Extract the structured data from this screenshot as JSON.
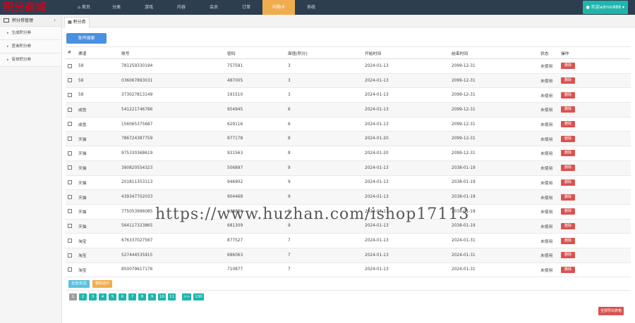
{
  "logo": "积分商城",
  "nav": [
    {
      "label": "首页",
      "active": false,
      "icon": "home-icon"
    },
    {
      "label": "分类",
      "active": false
    },
    {
      "label": "游戏",
      "active": false
    },
    {
      "label": "内容",
      "active": false
    },
    {
      "label": "会员",
      "active": false
    },
    {
      "label": "订单",
      "active": false
    },
    {
      "label": "内购卡",
      "active": true
    },
    {
      "label": "系统",
      "active": false
    }
  ],
  "user": {
    "label": "欢迎admin888",
    "icon": "user-icon"
  },
  "sidebar": {
    "title": "积分券管理",
    "items": [
      {
        "label": "生成积分券"
      },
      {
        "label": "查询积分券"
      },
      {
        "label": "有效积分券"
      }
    ]
  },
  "tab": {
    "label": "积分券"
  },
  "search_button": "条件搜索",
  "table": {
    "headers": [
      "#",
      "渠道",
      "账号",
      "密码",
      "面值(积分)",
      "开始时间",
      "结束时间",
      "状态",
      "操作"
    ],
    "delete_label": "删除",
    "rows": [
      {
        "channel": "58",
        "account": "781259330194",
        "password": "757591",
        "value": "3",
        "start": "2024-01-13",
        "end": "2099-12-31",
        "status": "未使用"
      },
      {
        "channel": "58",
        "account": "036067893031",
        "password": "487005",
        "value": "3",
        "start": "2024-01-13",
        "end": "2099-12-31",
        "status": "未使用"
      },
      {
        "channel": "58",
        "account": "373027813149",
        "password": "191510",
        "value": "3",
        "start": "2024-01-13",
        "end": "2099-12-31",
        "status": "未使用"
      },
      {
        "channel": "咸鱼",
        "account": "541221746786",
        "password": "954945",
        "value": "6",
        "start": "2024-01-13",
        "end": "2099-12-31",
        "status": "未使用"
      },
      {
        "channel": "咸鱼",
        "account": "156065375687",
        "password": "629116",
        "value": "6",
        "start": "2024-01-13",
        "end": "2099-12-31",
        "status": "未使用"
      },
      {
        "channel": "天猫",
        "account": "786724387759",
        "password": "977178",
        "value": "8",
        "start": "2024-01-20",
        "end": "2099-12-31",
        "status": "未使用"
      },
      {
        "channel": "天猫",
        "account": "975330368619",
        "password": "931563",
        "value": "8",
        "start": "2024-01-20",
        "end": "2099-12-31",
        "status": "未使用"
      },
      {
        "channel": "天猫",
        "account": "390820554323",
        "password": "506897",
        "value": "9",
        "start": "2024-01-13",
        "end": "2038-01-19",
        "status": "未使用"
      },
      {
        "channel": "天猫",
        "account": "201811353113",
        "password": "946902",
        "value": "9",
        "start": "2024-01-13",
        "end": "2038-01-19",
        "status": "未使用"
      },
      {
        "channel": "天猫",
        "account": "439347702033",
        "password": "904468",
        "value": "9",
        "start": "2024-01-13",
        "end": "2038-01-19",
        "status": "未使用"
      },
      {
        "channel": "天猫",
        "account": "775053996085",
        "password": "938886",
        "value": "9",
        "start": "2024-01-13",
        "end": "2038-01-19",
        "status": "未使用"
      },
      {
        "channel": "天猫",
        "account": "564117323865",
        "password": "681309",
        "value": "9",
        "start": "2024-01-13",
        "end": "2038-01-19",
        "status": "未使用"
      },
      {
        "channel": "淘宝",
        "account": "676337027567",
        "password": "877527",
        "value": "7",
        "start": "2024-01-13",
        "end": "2024-01-31",
        "status": "未使用"
      },
      {
        "channel": "淘宝",
        "account": "527444535915",
        "password": "686063",
        "value": "7",
        "start": "2024-01-13",
        "end": "2024-01-31",
        "status": "未使用"
      },
      {
        "channel": "淘宝",
        "account": "850079617176",
        "password": "710877",
        "value": "7",
        "start": "2024-01-13",
        "end": "2024-01-31",
        "status": "未使用"
      }
    ]
  },
  "footer": {
    "select_all": "全选/反选",
    "delete_selected": "删除选中"
  },
  "pagination": [
    "1",
    "2",
    "3",
    "4",
    "5",
    "6",
    "7",
    "8",
    "9",
    "10",
    "11",
    ">>",
    "130"
  ],
  "pagination_current": "1",
  "export_button": "全部导出表格",
  "watermark": "https://www.huzhan.com/ishop17113",
  "colors": {
    "topbar": "#2d3e50",
    "nav_active": "#f0ad4e",
    "teal": "#1fb5ac",
    "danger": "#d9534f",
    "primary": "#4a90e2",
    "status_green": "#3c9a3c",
    "logo_red": "#d0021b"
  }
}
